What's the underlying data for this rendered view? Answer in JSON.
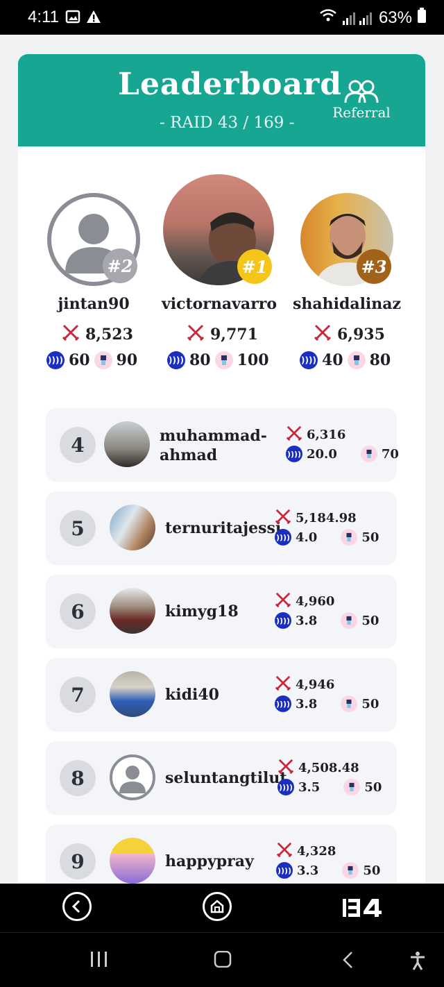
{
  "status": {
    "time": "4:11",
    "battery": "63%"
  },
  "header": {
    "title": "Leaderboard",
    "subtitle": "- RAID 43 / 169 -",
    "referral_label": "Referral"
  },
  "podium": [
    {
      "rank": "#2",
      "name": "jintan90",
      "score": "8,523",
      "steem": "60",
      "pet": "90",
      "badge_color": "#a6a8ae",
      "avatar": "placeholder"
    },
    {
      "rank": "#1",
      "name": "victornavarro",
      "score": "9,771",
      "steem": "80",
      "pet": "100",
      "badge_color": "#f5c518",
      "avatar": "photo"
    },
    {
      "rank": "#3",
      "name": "shahidalinaz",
      "score": "6,935",
      "steem": "40",
      "pet": "80",
      "badge_color": "#a3621a",
      "avatar": "photo"
    }
  ],
  "rows": [
    {
      "rank": "4",
      "name_line1": "muhammad-",
      "name_line2": "ahmad",
      "score": "6,316",
      "steem": "20.0",
      "pet": "70"
    },
    {
      "rank": "5",
      "name": "ternuritajessi",
      "score": "5,184.98",
      "steem": "4.0",
      "pet": "50"
    },
    {
      "rank": "6",
      "name": "kimyg18",
      "score": "4,960",
      "steem": "3.8",
      "pet": "50"
    },
    {
      "rank": "7",
      "name": "kidi40",
      "score": "4,946",
      "steem": "3.8",
      "pet": "50"
    },
    {
      "rank": "8",
      "name": "seluntangtilut",
      "score": "4,508.48",
      "steem": "3.5",
      "pet": "50"
    },
    {
      "rank": "9",
      "name": "happypray",
      "score": "4,328",
      "steem": "3.3",
      "pet": "50"
    }
  ],
  "colors": {
    "accent": "#16a692",
    "coin": "#1a2fbf",
    "sword": "#c8283c"
  }
}
